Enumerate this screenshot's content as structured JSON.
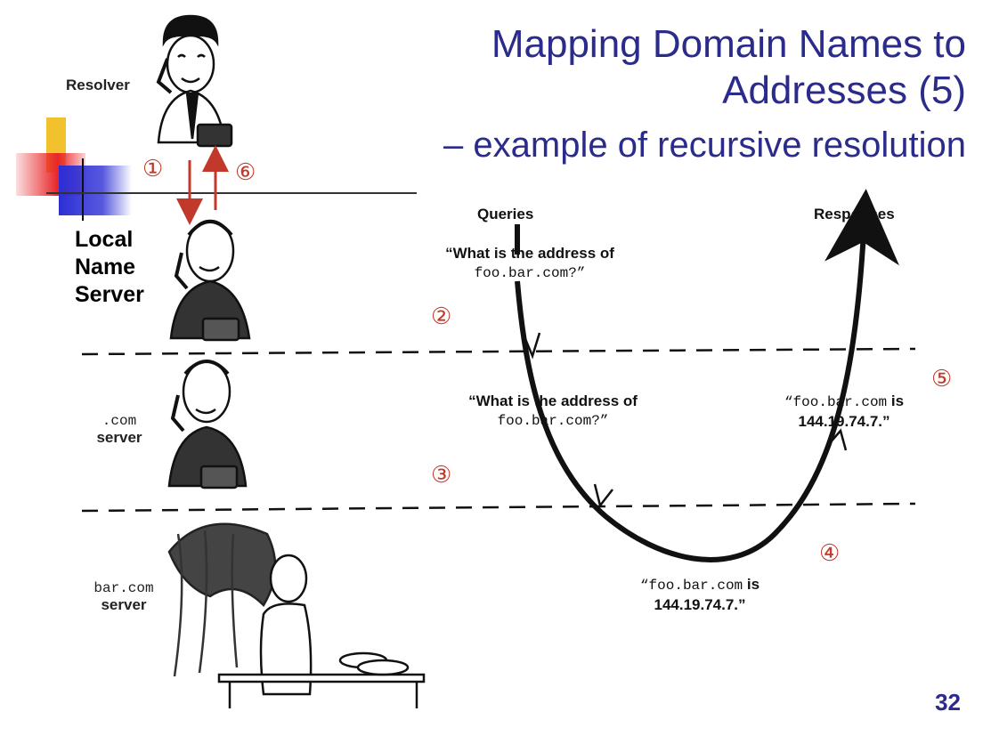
{
  "slide": {
    "title_line1": "Mapping Domain Names to",
    "title_line2": "Addresses (5)",
    "subtitle": "– example of recursive resolution",
    "page_number": "32"
  },
  "roles": {
    "resolver": "Resolver",
    "local_line1": "Local",
    "local_line2": "Name",
    "local_line3": "Server",
    "com_domain": ".com",
    "com_server": "server",
    "bar_domain": "bar.com",
    "bar_server": "server"
  },
  "diagram": {
    "queries_header": "Queries",
    "responses_header": "Responses",
    "query1_line1": "“What is the address of",
    "query1_line2": "foo.bar.com?”",
    "query2_line1": "“What is the address of",
    "query2_line2": "foo.bar.com?”",
    "response1_host": "“foo.bar.com",
    "response1_is": " is",
    "response1_ip": "144.19.74.7.”",
    "response2_host": "“foo.bar.com",
    "response2_is": " is",
    "response2_ip": "144.19.74.7.”"
  },
  "steps": [
    "①",
    "②",
    "③",
    "④",
    "⑤",
    "⑥"
  ],
  "colors": {
    "title": "#2b2b8c",
    "step_marker": "#c0392b",
    "arrow": "#c0392b",
    "deco_yellow": "#f2c12e",
    "deco_red": "#e8262a",
    "deco_blue": "#2d2fd6"
  }
}
